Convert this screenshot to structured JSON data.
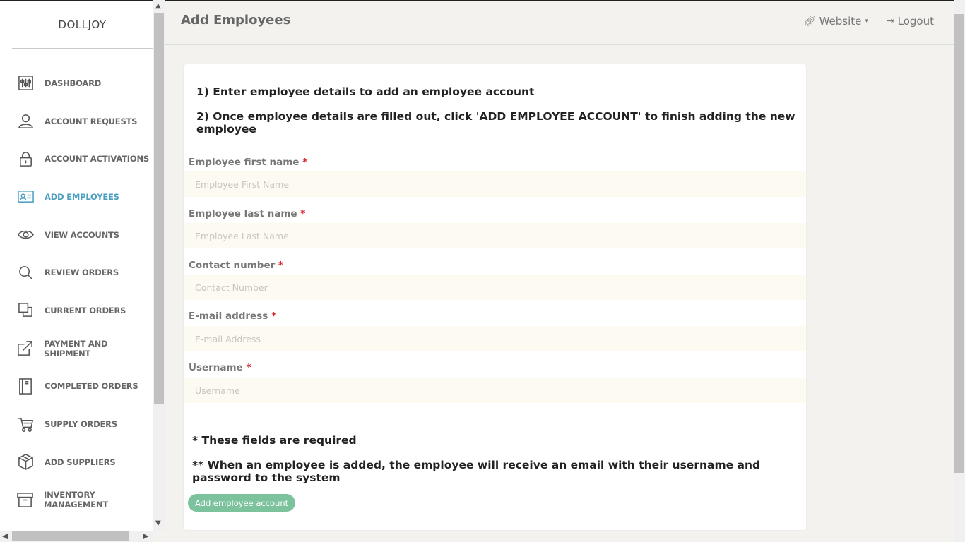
{
  "brand": "DOLLJOY",
  "sidebar": {
    "items": [
      {
        "label": "DASHBOARD",
        "icon": "sliders-icon"
      },
      {
        "label": "ACCOUNT REQUESTS",
        "icon": "user-icon"
      },
      {
        "label": "ACCOUNT ACTIVATIONS",
        "icon": "lock-icon"
      },
      {
        "label": "ADD EMPLOYEES",
        "icon": "id-card-icon",
        "active": true
      },
      {
        "label": "VIEW ACCOUNTS",
        "icon": "eye-icon"
      },
      {
        "label": "REVIEW ORDERS",
        "icon": "search-icon"
      },
      {
        "label": "CURRENT ORDERS",
        "icon": "copy-icon"
      },
      {
        "label": "PAYMENT AND SHIPMENT",
        "icon": "external-link-icon"
      },
      {
        "label": "COMPLETED ORDERS",
        "icon": "notebook-icon"
      },
      {
        "label": "SUPPLY ORDERS",
        "icon": "cart-icon"
      },
      {
        "label": "ADD SUPPLIERS",
        "icon": "box-icon"
      },
      {
        "label": "INVENTORY MANAGEMENT",
        "icon": "archive-icon"
      }
    ]
  },
  "header": {
    "title": "Add Employees",
    "website_label": "Website",
    "logout_label": "Logout"
  },
  "instructions": {
    "line1": "1) Enter employee details to add an employee account",
    "line2": "2) Once employee details are filled out, click 'ADD EMPLOYEE ACCOUNT' to finish adding the new employee"
  },
  "form": {
    "first_name": {
      "label": "Employee first name",
      "placeholder": "Employee First Name",
      "value": ""
    },
    "last_name": {
      "label": "Employee last name",
      "placeholder": "Employee Last Name",
      "value": ""
    },
    "contact": {
      "label": "Contact number",
      "placeholder": "Contact Number",
      "value": ""
    },
    "email": {
      "label": "E-mail address",
      "placeholder": "E-mail Address",
      "value": ""
    },
    "username": {
      "label": "Username",
      "placeholder": "Username",
      "value": ""
    },
    "required_mark": "*"
  },
  "notes": {
    "required": "* These fields are required",
    "email_note": "** When an employee is added, the employee will receive an email with their username and password to the system"
  },
  "submit_label": "Add employee account",
  "colors": {
    "active_nav": "#4a9fc1",
    "button": "#7bc29d",
    "required": "#d9262d",
    "input_bg": "#fdfaf2"
  }
}
